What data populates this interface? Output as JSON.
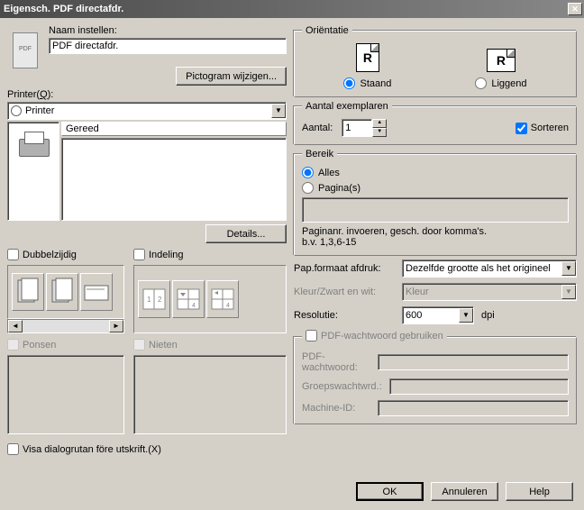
{
  "title": "Eigensch. PDF directafdr.",
  "name_label": "Naam instellen:",
  "name_value": "PDF directafdr.",
  "change_icon_btn": "Pictogram wijzigen...",
  "printer_label": "Printer(Q):",
  "printer_select": "Printer",
  "status": "Gereed",
  "details_btn": "Details...",
  "duplex_label": "Dubbelzijdig",
  "layout_label": "Indeling",
  "punch_label": "Ponsen",
  "staple_label": "Nieten",
  "show_dialog_label": "Visa dialogrutan före utskrift.(X)",
  "orientation": {
    "legend": "Oriëntatie",
    "portrait": "Staand",
    "landscape": "Liggend"
  },
  "copies": {
    "legend": "Aantal exemplaren",
    "count_label": "Aantal:",
    "count_value": "1",
    "collate": "Sorteren"
  },
  "range": {
    "legend": "Bereik",
    "all": "Alles",
    "pages": "Pagina(s)",
    "hint1": "Paginanr. invoeren, gesch. door komma's.",
    "hint2": "b.v. 1,3,6-15"
  },
  "paper_label": "Pap.formaat afdruk:",
  "paper_value": "Dezelfde grootte als het origineel",
  "color_label": "Kleur/Zwart en wit:",
  "color_value": "Kleur",
  "resolution_label": "Resolutie:",
  "resolution_value": "600",
  "resolution_unit": "dpi",
  "pdf_pass": {
    "legend": "PDF-wachtwoord gebruiken",
    "pdf_label": "PDF-wachtwoord:",
    "group_label": "Groepswachtwrd.:",
    "machine_label": "Machine-ID:"
  },
  "ok_btn": "OK",
  "cancel_btn": "Annuleren",
  "help_btn": "Help"
}
